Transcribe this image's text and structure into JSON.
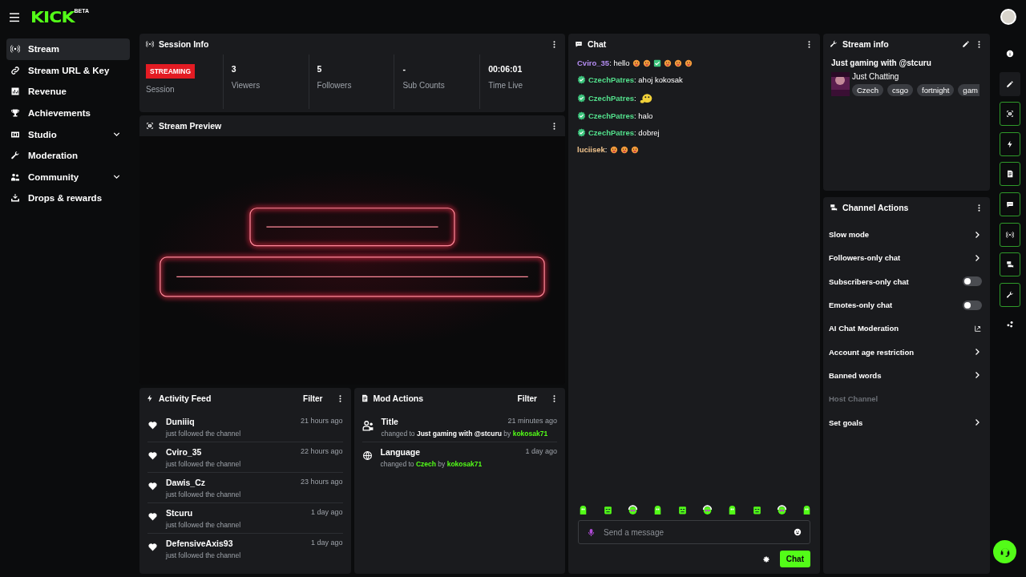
{
  "header": {
    "logo": "KICK",
    "logo_badge": "BETA"
  },
  "sidebar": {
    "items": [
      {
        "label": "Stream",
        "selected": true,
        "expandable": false
      },
      {
        "label": "Stream URL & Key",
        "selected": false,
        "expandable": false
      },
      {
        "label": "Revenue",
        "selected": false,
        "expandable": false
      },
      {
        "label": "Achievements",
        "selected": false,
        "expandable": false
      },
      {
        "label": "Studio",
        "selected": false,
        "expandable": true
      },
      {
        "label": "Moderation",
        "selected": false,
        "expandable": false
      },
      {
        "label": "Community",
        "selected": false,
        "expandable": true
      },
      {
        "label": "Drops & rewards",
        "selected": false,
        "expandable": false
      }
    ]
  },
  "session_info": {
    "title": "Session Info",
    "status_badge": "STREAMING",
    "status_label": "Session",
    "stats": [
      {
        "value": "3",
        "label": "Viewers"
      },
      {
        "value": "5",
        "label": "Followers"
      },
      {
        "value": "-",
        "label": "Sub Counts"
      },
      {
        "value": "00:06:01",
        "label": "Time Live"
      }
    ]
  },
  "stream_preview": {
    "title": "Stream Preview",
    "kind": "picture"
  },
  "activity_feed": {
    "title": "Activity Feed",
    "filter": "Filter",
    "items": [
      {
        "name": "Duniiiq",
        "time": "21 hours ago",
        "text": "just followed the channel"
      },
      {
        "name": "Cviro_35",
        "time": "22 hours ago",
        "text": "just followed the channel"
      },
      {
        "name": "Dawis_Cz",
        "time": "23 hours ago",
        "text": "just followed the channel"
      },
      {
        "name": "Stcuru",
        "time": "1 day ago",
        "text": "just followed the channel"
      },
      {
        "name": "DefensiveAxis93",
        "time": "1 day ago",
        "text": "just followed the channel"
      }
    ]
  },
  "mod_actions": {
    "title": "Mod Actions",
    "filter": "Filter",
    "items": [
      {
        "kind": "title",
        "label": "Title",
        "time": "21 minutes ago",
        "prefix": "changed to",
        "target": "Just gaming with @stcuru",
        "joiner": "by",
        "user": "kokosak71",
        "target_highlight": false
      },
      {
        "kind": "language",
        "label": "Language",
        "time": "1 day ago",
        "prefix": "changed to",
        "target": "Czech",
        "joiner": "by",
        "user": "kokosak71",
        "target_highlight": true
      }
    ]
  },
  "chat": {
    "title": "Chat",
    "messages": [
      {
        "user": "Cviro_35",
        "color": "#b48cf2",
        "verified": false,
        "text": ": hello",
        "emotes": [
          {
            "kind": "face"
          },
          {
            "kind": "face"
          },
          {
            "kind": "check"
          },
          {
            "kind": "face"
          },
          {
            "kind": "face"
          },
          {
            "kind": "face"
          }
        ]
      },
      {
        "user": "CzechPatres",
        "color": "#53e08c",
        "verified": true,
        "text": ": ahoj kokosak"
      },
      {
        "user": "CzechPatres",
        "color": "#53e08c",
        "verified": true,
        "text": ":",
        "emotes": [
          {
            "kind": "sticker"
          }
        ]
      },
      {
        "user": "CzechPatres",
        "color": "#53e08c",
        "verified": true,
        "text": ": halo"
      },
      {
        "user": "CzechPatres",
        "color": "#53e08c",
        "verified": true,
        "text": ": dobrej"
      },
      {
        "user": "luciisek",
        "color": "#f2c58e",
        "verified": false,
        "text": ":",
        "emotes": [
          {
            "kind": "face"
          },
          {
            "kind": "face"
          },
          {
            "kind": "face"
          }
        ]
      }
    ],
    "input": {
      "placeholder": "Send a message"
    },
    "send_button": "Chat"
  },
  "stream_info": {
    "title": "Stream info",
    "stream_title": "Just gaming with @stcuru",
    "category": "Just Chatting",
    "tags": [
      "Czech",
      "csgo",
      "fortnight",
      "gam"
    ]
  },
  "channel_actions": {
    "title": "Channel Actions",
    "items": [
      {
        "label": "Slow mode",
        "kind": "menu",
        "disabled": false
      },
      {
        "label": "Followers-only chat",
        "kind": "menu",
        "disabled": false
      },
      {
        "label": "Subscribers-only chat",
        "kind": "toggle",
        "on": false,
        "disabled": false
      },
      {
        "label": "Emotes-only chat",
        "kind": "toggle",
        "on": false,
        "disabled": false
      },
      {
        "label": "AI Chat Moderation",
        "kind": "external",
        "disabled": false
      },
      {
        "label": "Account age restriction",
        "kind": "menu",
        "disabled": false
      },
      {
        "label": "Banned words",
        "kind": "menu",
        "disabled": false
      },
      {
        "label": "Host Channel",
        "kind": "plain",
        "disabled": true
      },
      {
        "label": "Set goals",
        "kind": "menu",
        "disabled": false
      }
    ]
  },
  "rail": [
    {
      "active": false
    },
    {
      "active": false
    },
    {
      "active": true
    },
    {
      "active": true
    },
    {
      "active": true
    },
    {
      "active": true
    },
    {
      "active": true
    },
    {
      "active": true
    },
    {
      "active": true
    },
    {
      "active": false
    }
  ]
}
